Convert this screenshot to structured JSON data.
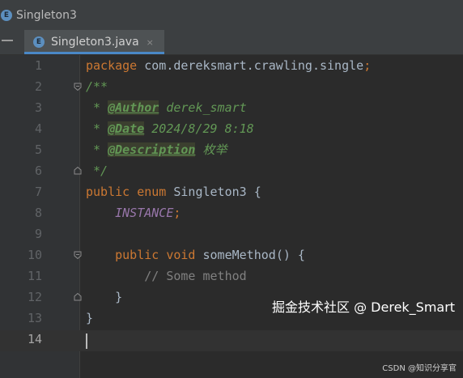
{
  "window": {
    "title": "Singleton3",
    "icon": "enum-file-icon",
    "icon_letter": "E"
  },
  "tabs": [
    {
      "label": "Singleton3.java",
      "icon": "enum-file-icon",
      "icon_letter": "E",
      "close": "×",
      "active": true
    }
  ],
  "editor": {
    "caret_line": 14,
    "lines": [
      {
        "num": "1",
        "tokens": [
          {
            "t": "package ",
            "c": "kw"
          },
          {
            "t": "com.dereksmart.crawling.single",
            "c": "plain"
          },
          {
            "t": ";",
            "c": "kw"
          }
        ]
      },
      {
        "num": "2",
        "tokens": [
          {
            "t": "/**",
            "c": "doc"
          }
        ],
        "fold": "start"
      },
      {
        "num": "3",
        "tokens": [
          {
            "t": " * ",
            "c": "doc"
          },
          {
            "t": "@Author",
            "c": "tag"
          },
          {
            "t": " derek_smart",
            "c": "doc"
          }
        ]
      },
      {
        "num": "4",
        "tokens": [
          {
            "t": " * ",
            "c": "doc"
          },
          {
            "t": "@Date",
            "c": "tag"
          },
          {
            "t": " 2024/8/29 8:18",
            "c": "doc"
          }
        ]
      },
      {
        "num": "5",
        "tokens": [
          {
            "t": " * ",
            "c": "doc"
          },
          {
            "t": "@Description",
            "c": "tag"
          },
          {
            "t": " ",
            "c": "doc"
          },
          {
            "t": "枚举",
            "c": "doc cn"
          }
        ]
      },
      {
        "num": "6",
        "tokens": [
          {
            "t": " */",
            "c": "doc"
          }
        ],
        "fold": "end"
      },
      {
        "num": "7",
        "tokens": [
          {
            "t": "public enum ",
            "c": "kw"
          },
          {
            "t": "Singleton3 ",
            "c": "cname"
          },
          {
            "t": "{",
            "c": "plain"
          }
        ]
      },
      {
        "num": "8",
        "tokens": [
          {
            "t": "    ",
            "c": "plain"
          },
          {
            "t": "INSTANCE",
            "c": "constant"
          },
          {
            "t": ";",
            "c": "kw"
          }
        ]
      },
      {
        "num": "9",
        "tokens": [
          {
            "t": "",
            "c": "plain"
          }
        ]
      },
      {
        "num": "10",
        "tokens": [
          {
            "t": "    ",
            "c": "plain"
          },
          {
            "t": "public void ",
            "c": "kw"
          },
          {
            "t": "someMethod",
            "c": "fn"
          },
          {
            "t": "() {",
            "c": "plain"
          }
        ],
        "fold": "start"
      },
      {
        "num": "11",
        "tokens": [
          {
            "t": "        ",
            "c": "plain"
          },
          {
            "t": "// Some method",
            "c": "comment"
          }
        ]
      },
      {
        "num": "12",
        "tokens": [
          {
            "t": "    ",
            "c": "plain"
          },
          {
            "t": "}",
            "c": "plain"
          }
        ],
        "fold": "end"
      },
      {
        "num": "13",
        "tokens": [
          {
            "t": "}",
            "c": "plain"
          }
        ]
      },
      {
        "num": "14",
        "tokens": [
          {
            "t": "",
            "c": "plain"
          }
        ]
      }
    ]
  },
  "watermark": {
    "text": "掘金技术社区 @ Derek_Smart",
    "source": "CSDN @知识分享官"
  },
  "colors": {
    "background": "#2b2b2b",
    "keyword": "#cc7832",
    "doc_comment": "#629755",
    "identifier": "#a9b7c6",
    "constant": "#9876aa",
    "comment": "#808080",
    "tab_underline": "#4a88c7"
  }
}
